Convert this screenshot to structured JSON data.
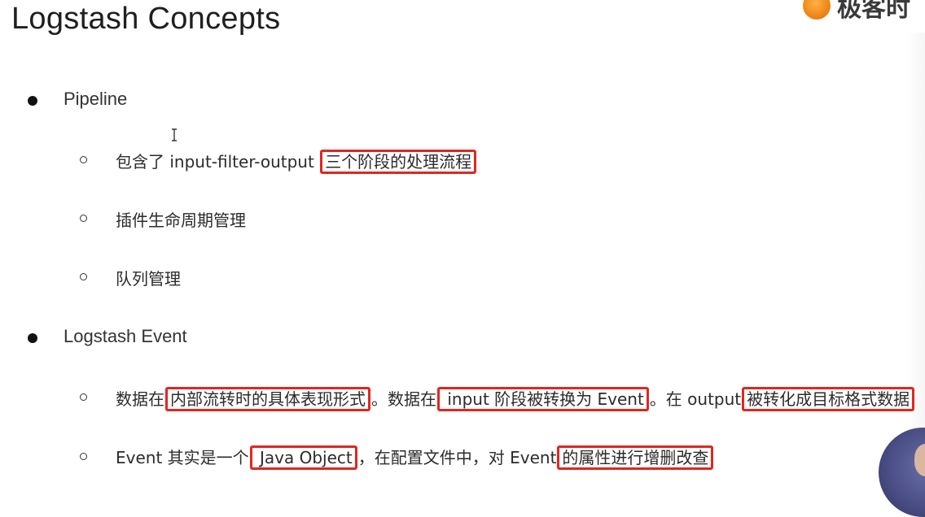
{
  "slide": {
    "title": "Logstash Concepts",
    "logo_text": "极客时",
    "items": [
      {
        "label": "Pipeline",
        "sub": [
          {
            "parts": [
              {
                "text": "包含了 input-filter-output ",
                "hl": false
              },
              {
                "text": "三个阶段的处理流程",
                "hl": true
              }
            ]
          },
          {
            "parts": [
              {
                "text": "插件生命周期管理",
                "hl": false
              }
            ]
          },
          {
            "parts": [
              {
                "text": "队列管理",
                "hl": false
              }
            ]
          }
        ]
      },
      {
        "label": "Logstash Event",
        "sub": [
          {
            "parts": [
              {
                "text": "数据在",
                "hl": false
              },
              {
                "text": "内部流转时的具体表现形式",
                "hl": true
              },
              {
                "text": "。数据在",
                "hl": false
              },
              {
                "text": " input 阶段被转换为 Event",
                "hl": true
              },
              {
                "text": "。在 output",
                "hl": false
              },
              {
                "text": "被转化成目标格式数据",
                "hl": true
              }
            ]
          },
          {
            "parts": [
              {
                "text": "Event 其实是一个",
                "hl": false
              },
              {
                "text": " Java Object",
                "hl": true
              },
              {
                "text": "，在配置文件中，对 Event",
                "hl": false
              },
              {
                "text": "的属性进行增删改查",
                "hl": true
              }
            ]
          }
        ]
      }
    ]
  },
  "icons": {
    "logo": "geektime-logo-icon",
    "cursor": "text-cursor-icon",
    "presenter": "presenter-avatar"
  },
  "colors": {
    "highlight_border": "#e0271f",
    "text": "#2b2b2b",
    "background": "#ffffff"
  }
}
